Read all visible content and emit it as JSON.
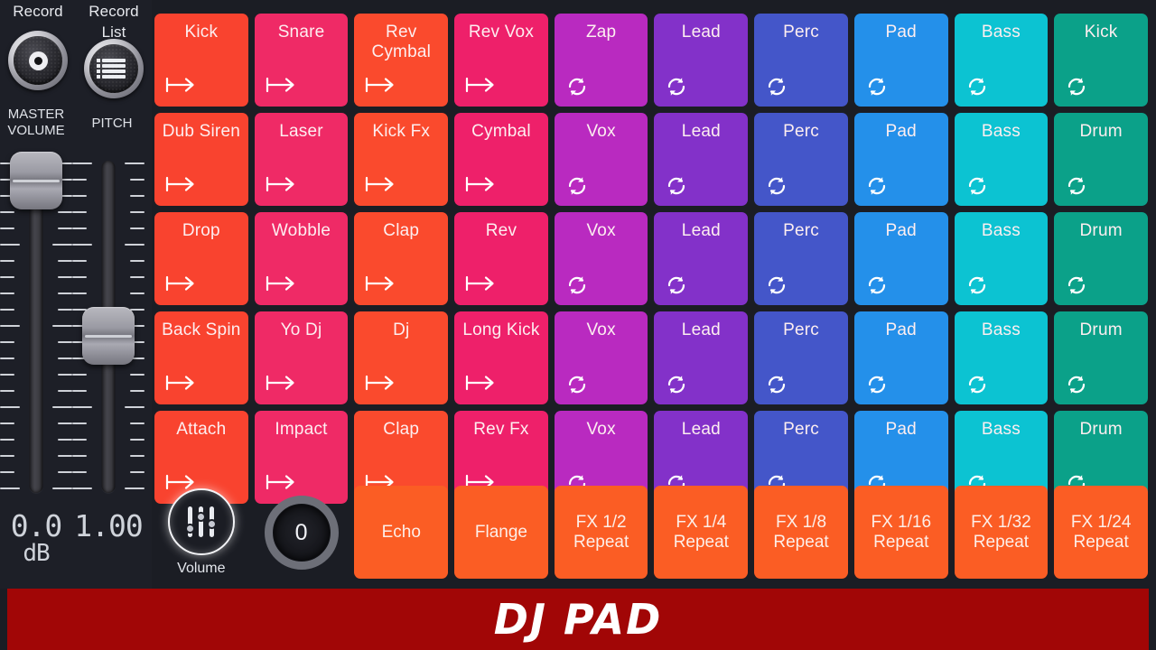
{
  "app": {
    "banner_title": "DJ PAD",
    "banner_color": "#a10606",
    "background": "#1b1d24"
  },
  "left_panel": {
    "record": {
      "label": "Record",
      "icon": "record-dot-icon"
    },
    "record_list": {
      "label": "Record List",
      "label_line1": "Record",
      "label_line2": "List",
      "icon": "list-icon"
    },
    "master_volume": {
      "title_line1": "MASTER",
      "title_line2": "VOLUME",
      "value": "0.0",
      "unit": "dB"
    },
    "pitch": {
      "title": "PITCH",
      "value": "1.00",
      "unit": ""
    }
  },
  "bottom_controls": {
    "volume": {
      "label": "Volume",
      "icon": "mixer-sliders-icon"
    },
    "knob": {
      "value": "0",
      "icon": "rotary-knob-icon"
    }
  },
  "colors": {
    "col1": "#f9432f",
    "col2": "#ef2a66",
    "col3": "#fa4a2d",
    "col4": "#ee206a",
    "col5": "#b92ac0",
    "col6": "#8331c9",
    "col7": "#4456c9",
    "col8": "#2490ea",
    "col9": "#0cc3d2",
    "col10": "#0ba189",
    "fx": "#fb5d24"
  },
  "pad_grid": {
    "columns": 10,
    "rows": 5,
    "mode_icons": {
      "one_shot": "arrow-right-icon",
      "loop": "loop-icon"
    },
    "pads": [
      [
        {
          "label": "Kick",
          "color": "#f9432f",
          "mode": "one_shot"
        },
        {
          "label": "Snare",
          "color": "#ef2a66",
          "mode": "one_shot"
        },
        {
          "label": "Rev Cymbal",
          "color": "#fa4a2d",
          "mode": "one_shot"
        },
        {
          "label": "Rev Vox",
          "color": "#ee206a",
          "mode": "one_shot"
        },
        {
          "label": "Zap",
          "color": "#b92ac0",
          "mode": "loop"
        },
        {
          "label": "Lead",
          "color": "#8331c9",
          "mode": "loop"
        },
        {
          "label": "Perc",
          "color": "#4456c9",
          "mode": "loop"
        },
        {
          "label": "Pad",
          "color": "#2490ea",
          "mode": "loop"
        },
        {
          "label": "Bass",
          "color": "#0cc3d2",
          "mode": "loop"
        },
        {
          "label": "Kick",
          "color": "#0ba189",
          "mode": "loop"
        }
      ],
      [
        {
          "label": "Dub Siren",
          "color": "#f9432f",
          "mode": "one_shot"
        },
        {
          "label": "Laser",
          "color": "#ef2a66",
          "mode": "one_shot"
        },
        {
          "label": "Kick Fx",
          "color": "#fa4a2d",
          "mode": "one_shot"
        },
        {
          "label": "Cymbal",
          "color": "#ee206a",
          "mode": "one_shot"
        },
        {
          "label": "Vox",
          "color": "#b92ac0",
          "mode": "loop"
        },
        {
          "label": "Lead",
          "color": "#8331c9",
          "mode": "loop"
        },
        {
          "label": "Perc",
          "color": "#4456c9",
          "mode": "loop"
        },
        {
          "label": "Pad",
          "color": "#2490ea",
          "mode": "loop"
        },
        {
          "label": "Bass",
          "color": "#0cc3d2",
          "mode": "loop"
        },
        {
          "label": "Drum",
          "color": "#0ba189",
          "mode": "loop"
        }
      ],
      [
        {
          "label": "Drop",
          "color": "#f9432f",
          "mode": "one_shot"
        },
        {
          "label": "Wobble",
          "color": "#ef2a66",
          "mode": "one_shot"
        },
        {
          "label": "Clap",
          "color": "#fa4a2d",
          "mode": "one_shot"
        },
        {
          "label": "Rev",
          "color": "#ee206a",
          "mode": "one_shot"
        },
        {
          "label": "Vox",
          "color": "#b92ac0",
          "mode": "loop"
        },
        {
          "label": "Lead",
          "color": "#8331c9",
          "mode": "loop"
        },
        {
          "label": "Perc",
          "color": "#4456c9",
          "mode": "loop"
        },
        {
          "label": "Pad",
          "color": "#2490ea",
          "mode": "loop"
        },
        {
          "label": "Bass",
          "color": "#0cc3d2",
          "mode": "loop"
        },
        {
          "label": "Drum",
          "color": "#0ba189",
          "mode": "loop"
        }
      ],
      [
        {
          "label": "Back Spin",
          "color": "#f9432f",
          "mode": "one_shot"
        },
        {
          "label": "Yo Dj",
          "color": "#ef2a66",
          "mode": "one_shot"
        },
        {
          "label": "Dj",
          "color": "#fa4a2d",
          "mode": "one_shot"
        },
        {
          "label": "Long Kick",
          "color": "#ee206a",
          "mode": "one_shot"
        },
        {
          "label": "Vox",
          "color": "#b92ac0",
          "mode": "loop"
        },
        {
          "label": "Lead",
          "color": "#8331c9",
          "mode": "loop"
        },
        {
          "label": "Perc",
          "color": "#4456c9",
          "mode": "loop"
        },
        {
          "label": "Pad",
          "color": "#2490ea",
          "mode": "loop"
        },
        {
          "label": "Bass",
          "color": "#0cc3d2",
          "mode": "loop"
        },
        {
          "label": "Drum",
          "color": "#0ba189",
          "mode": "loop"
        }
      ],
      [
        {
          "label": "Attach",
          "color": "#f9432f",
          "mode": "one_shot"
        },
        {
          "label": "Impact",
          "color": "#ef2a66",
          "mode": "one_shot"
        },
        {
          "label": "Clap",
          "color": "#fa4a2d",
          "mode": "one_shot"
        },
        {
          "label": "Rev Fx",
          "color": "#ee206a",
          "mode": "one_shot"
        },
        {
          "label": "Vox",
          "color": "#b92ac0",
          "mode": "loop"
        },
        {
          "label": "Lead",
          "color": "#8331c9",
          "mode": "loop"
        },
        {
          "label": "Perc",
          "color": "#4456c9",
          "mode": "loop"
        },
        {
          "label": "Pad",
          "color": "#2490ea",
          "mode": "loop"
        },
        {
          "label": "Bass",
          "color": "#0cc3d2",
          "mode": "loop"
        },
        {
          "label": "Drum",
          "color": "#0ba189",
          "mode": "loop"
        }
      ]
    ]
  },
  "fx_row": [
    {
      "label": "Echo",
      "color": "#fb5d24"
    },
    {
      "label": "Flange",
      "color": "#fb5d24"
    },
    {
      "label": "FX 1/2 Repeat",
      "color": "#fb5d24"
    },
    {
      "label": "FX 1/4 Repeat",
      "color": "#fb5d24"
    },
    {
      "label": "FX 1/8 Repeat",
      "color": "#fb5d24"
    },
    {
      "label": "FX 1/16 Repeat",
      "color": "#fb5d24"
    },
    {
      "label": "FX 1/32 Repeat",
      "color": "#fb5d24"
    },
    {
      "label": "FX 1/24 Repeat",
      "color": "#fb5d24"
    }
  ]
}
